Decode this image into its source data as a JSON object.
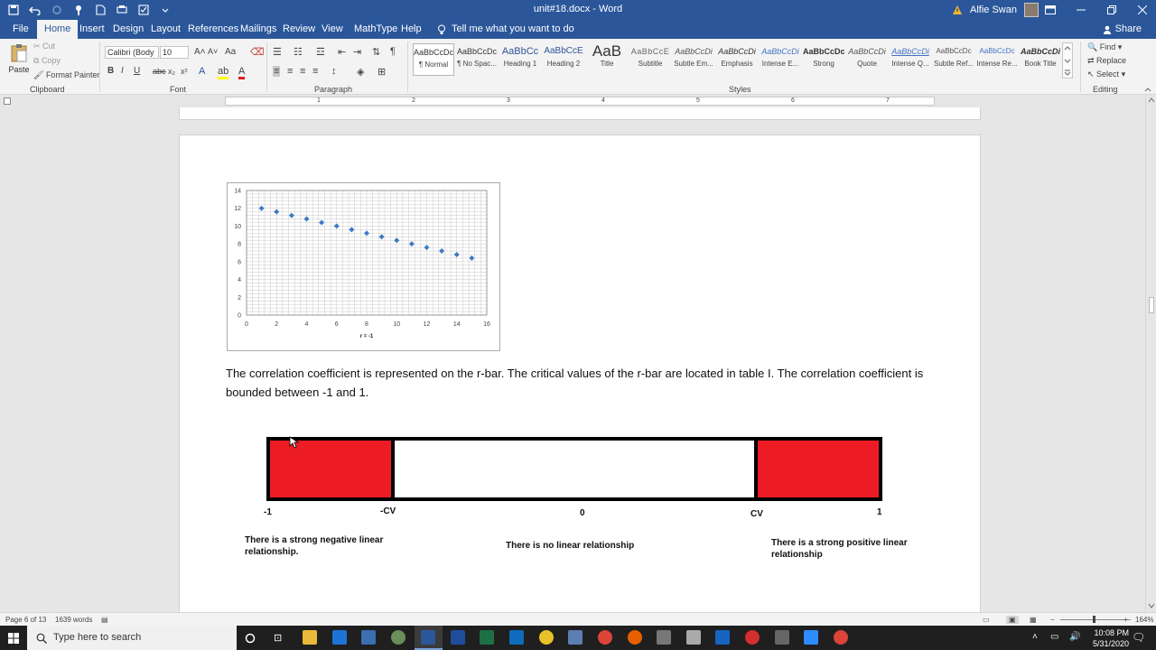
{
  "window": {
    "doc_title": "unit#18.docx - Word",
    "user_name": "Alfie Swan"
  },
  "tabs": [
    "File",
    "Home",
    "Insert",
    "Design",
    "Layout",
    "References",
    "Mailings",
    "Review",
    "View",
    "MathType",
    "Help"
  ],
  "active_tab": "Home",
  "tell_me": "Tell me what you want to do",
  "share": "Share",
  "clipboard": {
    "paste": "Paste",
    "cut": "Cut",
    "copy": "Copy",
    "format_painter": "Format Painter",
    "label": "Clipboard"
  },
  "font": {
    "name": "Calibri (Body",
    "size": "10",
    "label": "Font"
  },
  "paragraph": {
    "label": "Paragraph"
  },
  "styles": {
    "label": "Styles",
    "items": [
      {
        "preview": "AaBbCcDc",
        "name": "¶ Normal"
      },
      {
        "preview": "AaBbCcDc",
        "name": "¶ No Spac..."
      },
      {
        "preview": "AaBbCc",
        "name": "Heading 1"
      },
      {
        "preview": "AaBbCcE",
        "name": "Heading 2"
      },
      {
        "preview": "AaB",
        "name": "Title"
      },
      {
        "preview": "AaBbCcE",
        "name": "Subtitle"
      },
      {
        "preview": "AaBbCcDi",
        "name": "Subtle Em..."
      },
      {
        "preview": "AaBbCcDi",
        "name": "Emphasis"
      },
      {
        "preview": "AaBbCcDi",
        "name": "Intense E..."
      },
      {
        "preview": "AaBbCcDc",
        "name": "Strong"
      },
      {
        "preview": "AaBbCcDi",
        "name": "Quote"
      },
      {
        "preview": "AaBbCcDi",
        "name": "Intense Q..."
      },
      {
        "preview": "AaBbCcDc",
        "name": "Subtle Ref..."
      },
      {
        "preview": "AaBbCcDc",
        "name": "Intense Re..."
      },
      {
        "preview": "AaBbCcDi",
        "name": "Book Title"
      }
    ]
  },
  "editing": {
    "find": "Find",
    "replace": "Replace",
    "select": "Select",
    "label": "Editing"
  },
  "ruler_numbers": [
    "1",
    "2",
    "3",
    "4",
    "5",
    "6",
    "7"
  ],
  "chart_data": {
    "type": "scatter",
    "x": [
      1,
      2,
      3,
      4,
      5,
      6,
      7,
      8,
      9,
      10,
      11,
      12,
      13,
      14,
      15
    ],
    "y": [
      12,
      11.6,
      11.2,
      10.8,
      10.4,
      10.0,
      9.6,
      9.2,
      8.8,
      8.4,
      8.0,
      7.6,
      7.2,
      6.8,
      6.4
    ],
    "xlim": [
      0,
      16
    ],
    "ylim": [
      0,
      14
    ],
    "xticks": [
      0,
      2,
      4,
      6,
      8,
      10,
      12,
      14,
      16
    ],
    "yticks": [
      0,
      2,
      4,
      6,
      8,
      10,
      12,
      14
    ],
    "xlabel": "r = -1",
    "grid": true,
    "color": "#3d7ac4"
  },
  "body_text": "The correlation coefficient is represented on the r-bar. The critical values of the r-bar are located in table I. The correlation coefficient is bounded between -1 and 1.",
  "rbar": {
    "labels": [
      "-1",
      "-CV",
      "0",
      "CV",
      "1"
    ],
    "left_desc": "There is a strong negative linear relationship.",
    "center_desc": "There is no linear relationship",
    "right_desc": "There is a strong positive linear relationship",
    "red": "#ed1c24"
  },
  "status": {
    "page": "Page 6 of 13",
    "words": "1639 words",
    "zoom": "164%"
  },
  "taskbar": {
    "search_placeholder": "Type here to search",
    "time": "10:08 PM",
    "date": "5/31/2020"
  }
}
